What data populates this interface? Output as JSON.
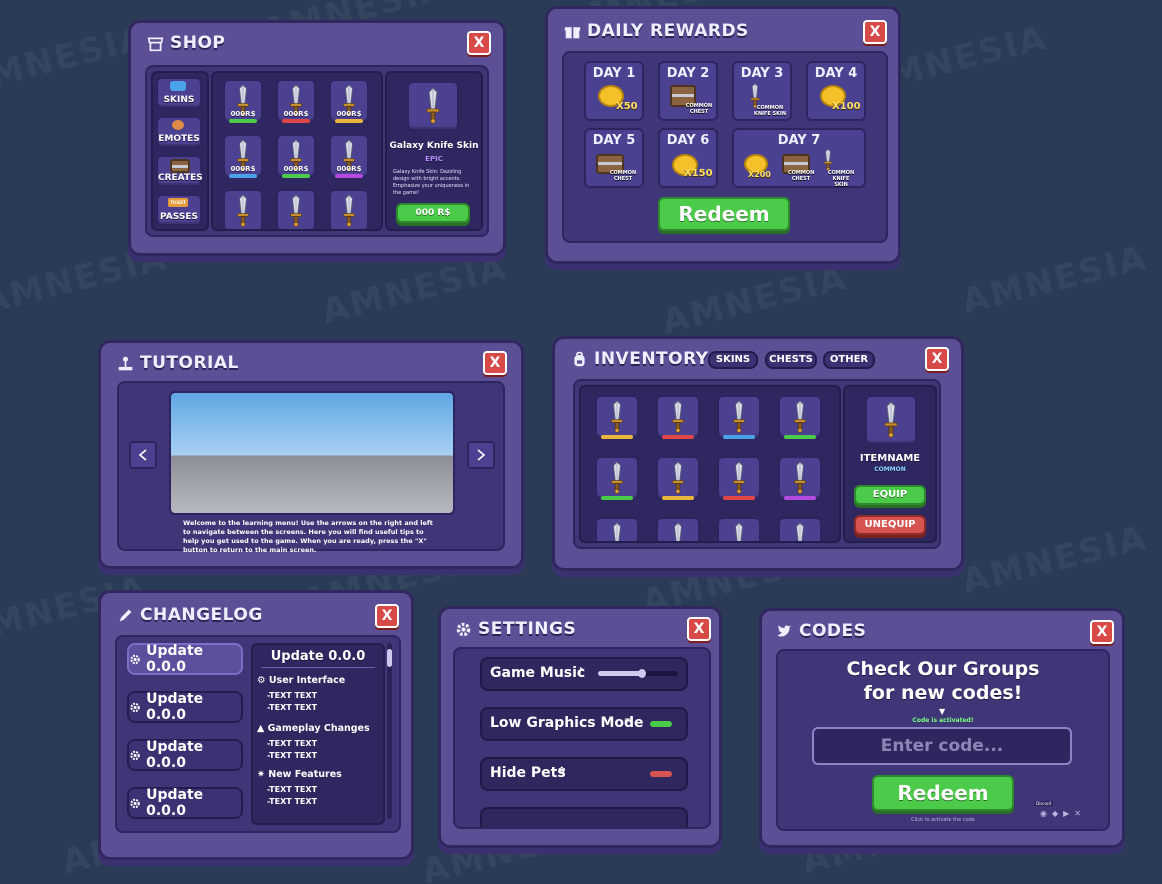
{
  "watermark": "AMNESIA",
  "shop": {
    "title": "SHOP",
    "close": "X",
    "categories": [
      "SKINS",
      "EMOTES",
      "CREATES",
      "PASSES"
    ],
    "ticket_label": "TICKET",
    "price_tag": "000R$",
    "item": {
      "name": "Galaxy Knife Skin",
      "rarity": "EPIC",
      "description": "Galaxy Knife Skin: Dazzling design with bright accents. Emphasize your uniqueness in the game!",
      "price": "000 R$"
    }
  },
  "daily": {
    "title": "DAILY REWARDS",
    "close": "X",
    "days": [
      "DAY 1",
      "DAY 2",
      "DAY 3",
      "DAY 4",
      "DAY 5",
      "DAY 6",
      "DAY 7"
    ],
    "qty": {
      "d1": "X50",
      "d4": "X100",
      "d6": "X150",
      "d7": "X200"
    },
    "common_chest": "COMMON CHEST",
    "common_knife": "COMMON KNIFE SKIN",
    "redeem": "Redeem"
  },
  "tutorial": {
    "title": "TUTORIAL",
    "close": "X",
    "text": "Welcome to the learning menu! Use the arrows on the right and left to navigate between the screens. Here you will find useful tips to help you get used to the game. When you are ready, press the \"X\" button to return to the main screen."
  },
  "inventory": {
    "title": "INVENTORY",
    "close": "X",
    "tabs": [
      "SKINS",
      "CHESTS",
      "OTHER"
    ],
    "item_name": "ITEMNAME",
    "item_rarity": "COMMON",
    "equip": "EQUIP",
    "unequip": "UNEQUIP"
  },
  "changelog": {
    "title": "CHANGELOG",
    "close": "X",
    "updates": [
      "Update 0.0.0",
      "Update 0.0.0",
      "Update 0.0.0",
      "Update 0.0.0"
    ],
    "detail_title": "Update 0.0.0",
    "sections": [
      "User Interface",
      "Gameplay Changes",
      "New Features"
    ],
    "line": "-TEXT TEXT"
  },
  "settings": {
    "title": "SETTINGS",
    "close": "X",
    "rows": [
      "Game Music",
      "Low Graphics Mode",
      "Hide Pets"
    ],
    "music_level": 0.55
  },
  "codes": {
    "title": "CODES",
    "close": "X",
    "headline1": "Check Our Groups",
    "headline2": "for new codes!",
    "status": "Code is activated!",
    "placeholder": "Enter code...",
    "redeem": "Redeem",
    "footer": "Click to activate the code",
    "social_tag": "Discord"
  },
  "colors": {
    "accent_green": "#4ccb4a",
    "accent_red": "#d65450",
    "panel": "#5c4f96",
    "rarity_gold": "#e9b53a",
    "rarity_red": "#e04848",
    "rarity_blue": "#4aa3e8",
    "rarity_green": "#4ccb4a",
    "rarity_purple": "#b44ae0"
  }
}
